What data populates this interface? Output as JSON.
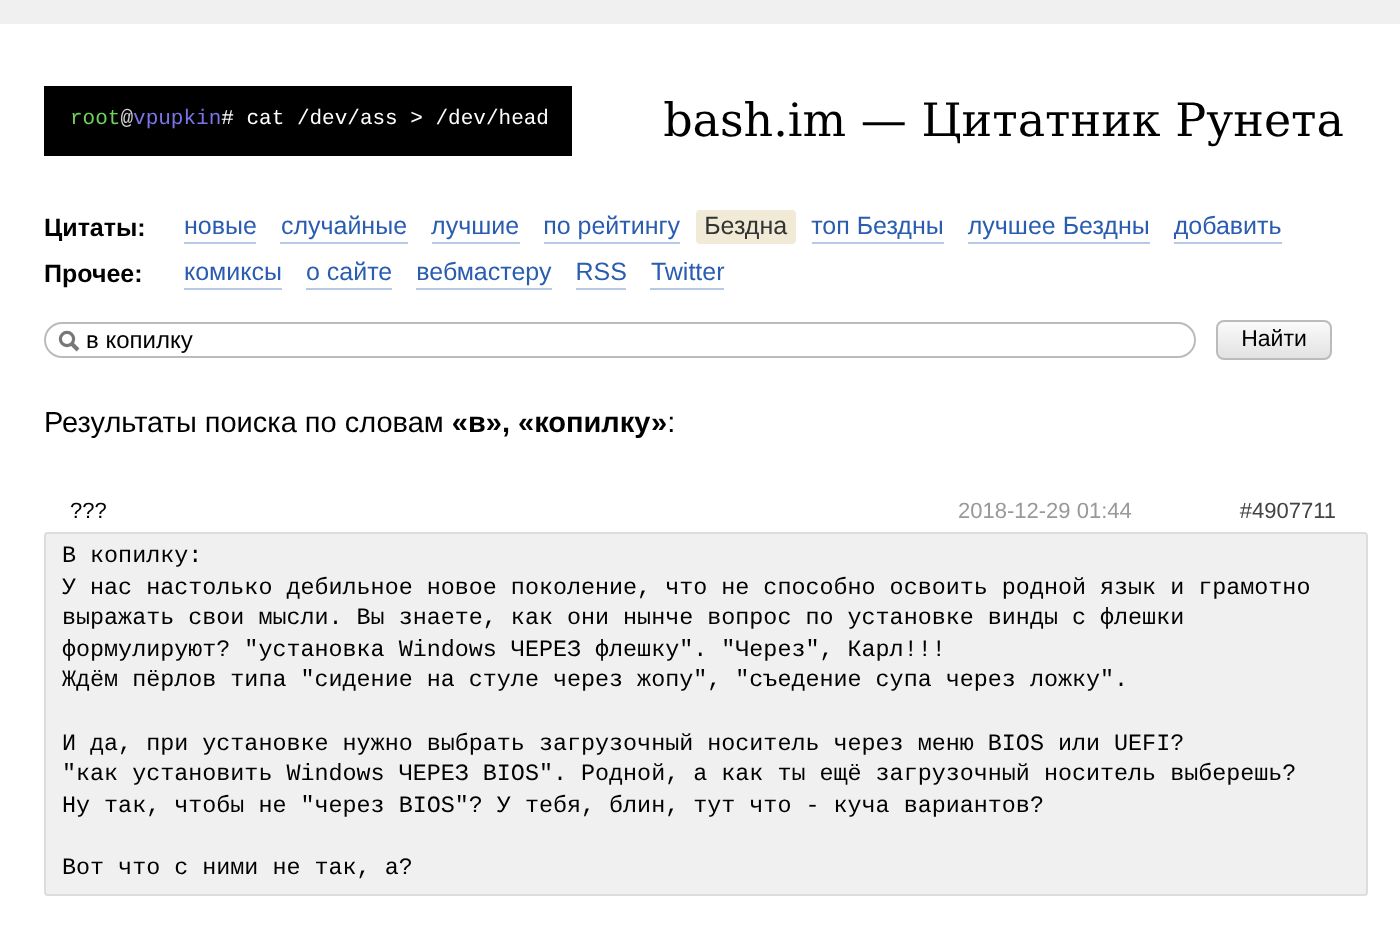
{
  "logo": {
    "parts": [
      {
        "kind": "user",
        "text": "root"
      },
      {
        "kind": "at",
        "text": "@"
      },
      {
        "kind": "host",
        "text": "vpupkin"
      },
      {
        "kind": "command",
        "text": "# cat /dev/ass > /dev/head"
      }
    ]
  },
  "site_title": "bash.im — Цитатник Рунета",
  "nav": [
    {
      "label": "Цитаты:",
      "links": [
        {
          "text": "новые",
          "selected": false
        },
        {
          "text": "случайные",
          "selected": false
        },
        {
          "text": "лучшие",
          "selected": false
        },
        {
          "text": "по рейтингу",
          "selected": false
        },
        {
          "text": "Бездна",
          "selected": true
        },
        {
          "text": "топ Бездны",
          "selected": false
        },
        {
          "text": "лучшее Бездны",
          "selected": false
        },
        {
          "text": "добавить",
          "selected": false
        }
      ]
    },
    {
      "label": "Прочее:",
      "links": [
        {
          "text": "комиксы",
          "selected": false
        },
        {
          "text": "о сайте",
          "selected": false
        },
        {
          "text": "вебмастеру",
          "selected": false
        },
        {
          "text": "RSS",
          "selected": false
        },
        {
          "text": "Twitter",
          "selected": false
        }
      ]
    }
  ],
  "search": {
    "value": "в копилку",
    "button": "Найти"
  },
  "results_heading": "Результаты поиска по словам **«в», «копилку»**:",
  "quotes": [
    {
      "rating": "???",
      "date": "2018-12-29 01:44",
      "id": "#4907711",
      "paragraphs": [
        "В копилку:\nУ нас настолько дебильное новое поколение, что не способно освоить родной язык и грамотно\nвыражать свои мысли. Вы знаете, как они нынче вопрос по установке винды с флешки\nформулируют? \"установка Windows ЧЕРЕЗ флешку\". \"Через\", Карл!!!\nЖдём пёрлов типа \"сидение на стуле через жопу\", \"съедение супа через ложку\".",
        "И да, при установке нужно выбрать загрузочный носитель через меню BIOS или UEFI?\n\"как установить Windows ЧЕРЕЗ BIOS\". Родной, а как ты ещё загрузочный носитель выберешь?\nНу так, чтобы не \"через BIOS\"? У тебя, блин, тут что - куча вариантов?",
        "Вот что с ними не так, а?"
      ]
    }
  ]
}
